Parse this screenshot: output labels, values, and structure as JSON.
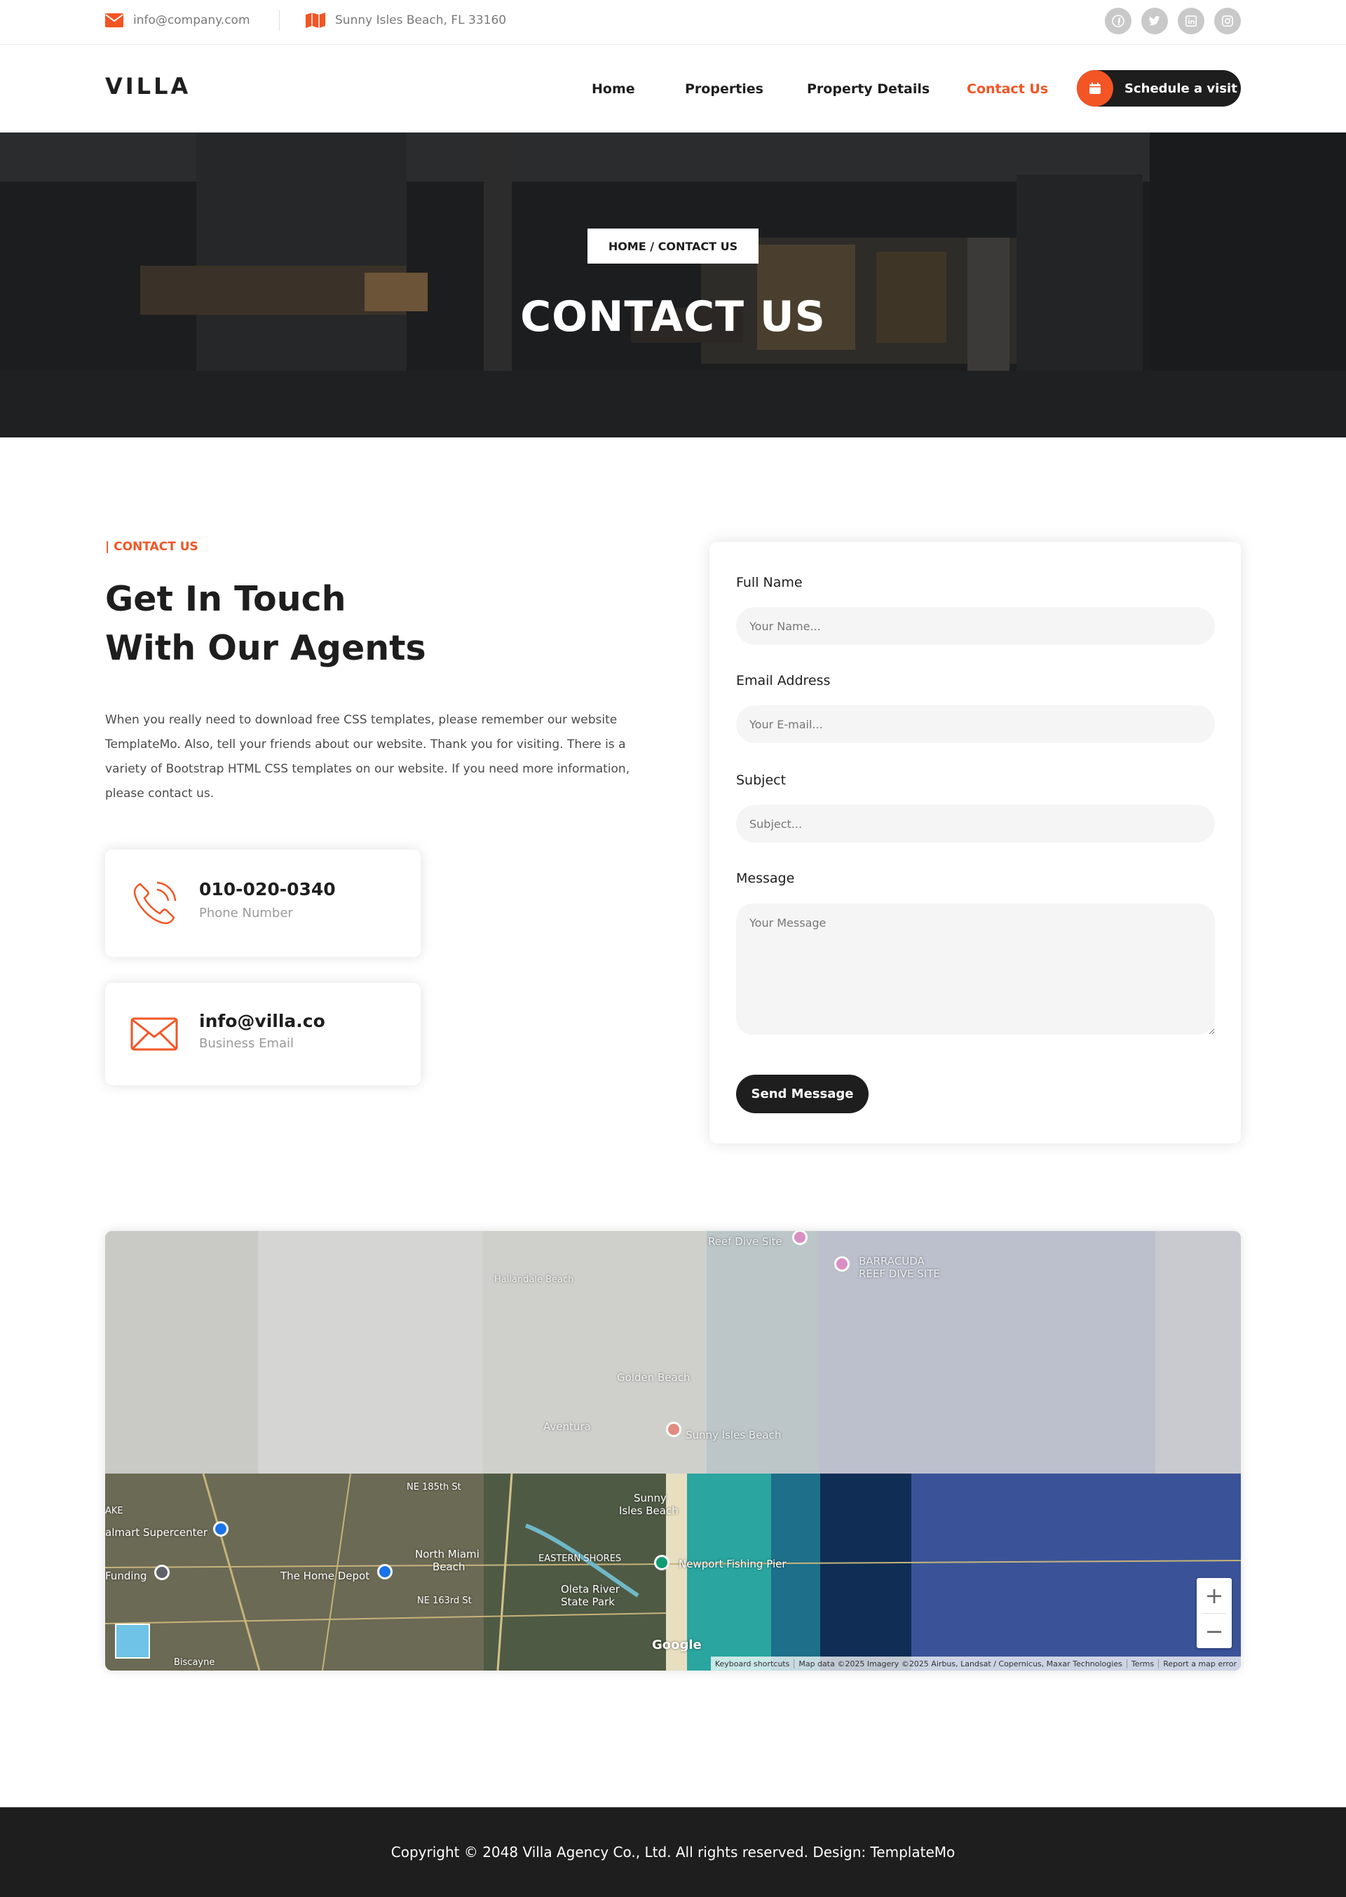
{
  "topbar": {
    "email": "info@company.com",
    "address": "Sunny Isles Beach, FL 33160",
    "socials": [
      "facebook-icon",
      "twitter-icon",
      "linkedin-icon",
      "instagram-icon"
    ]
  },
  "header": {
    "logo": "VILLA",
    "nav": {
      "home": "Home",
      "properties": "Properties",
      "property_details": "Property Details",
      "contact_us": "Contact Us"
    },
    "cta_label": "Schedule a visit"
  },
  "hero": {
    "breadcrumb": "HOME / CONTACT US",
    "title": "CONTACT US"
  },
  "contact": {
    "section_label": "| CONTACT US",
    "title_line1": "Get In Touch",
    "title_line2": "With Our Agents",
    "description": "When you really need to download free CSS templates, please remember our website TemplateMo. Also, tell your friends about our website. Thank you for visiting. There is a variety of Bootstrap HTML CSS templates on our website. If you need more information, please contact us.",
    "phone": {
      "value": "010-020-0340",
      "label": "Phone Number"
    },
    "email": {
      "value": "info@villa.co",
      "label": "Business Email"
    }
  },
  "form": {
    "name_label": "Full Name",
    "name_placeholder": "Your Name...",
    "email_label": "Email Address",
    "email_placeholder": "Your E-mail...",
    "subject_label": "Subject",
    "subject_placeholder": "Subject...",
    "message_label": "Message",
    "message_placeholder": "Your Message",
    "send_label": "Send Message"
  },
  "map": {
    "labels": {
      "reef": "Reef Dive Site",
      "barracuda1": "BARRACUDA",
      "barracuda2": "REEF DIVE SITE",
      "hallandale": "Hallandale Beach",
      "golden": "Golden Beach",
      "aventura": "Aventura",
      "sunny_faint": "Sunny Isles Beach",
      "sunny1": "Sunny",
      "sunny2": "Isles Beach",
      "walmart": "almart Supercenter",
      "home_depot": "The Home Depot",
      "north_miami1": "North Miami",
      "north_miami2": "Beach",
      "eastern": "EASTERN SHORES",
      "oleta1": "Oleta River",
      "oleta2": "State Park",
      "newport": "Newport Fishing Pier",
      "funding": "Funding",
      "ne185": "NE 185th St",
      "ne163": "NE 163rd St",
      "ake": "AKE",
      "biscayne": "Biscayne"
    },
    "zoom_in": "+",
    "zoom_out": "−",
    "google": "Google",
    "attribution": {
      "shortcuts": "Keyboard shortcuts",
      "data": "Map data ©2025 Imagery ©2025 Airbus, Landsat / Copernicus, Maxar Technologies",
      "terms": "Terms",
      "report": "Report a map error"
    }
  },
  "footer": {
    "copyright": "Copyright © 2048 Villa Agency Co., Ltd. All rights reserved. Design: TemplateMo"
  },
  "colors": {
    "accent": "#f35525",
    "dark": "#1e1e1e",
    "field_bg": "#f5f5f5"
  }
}
